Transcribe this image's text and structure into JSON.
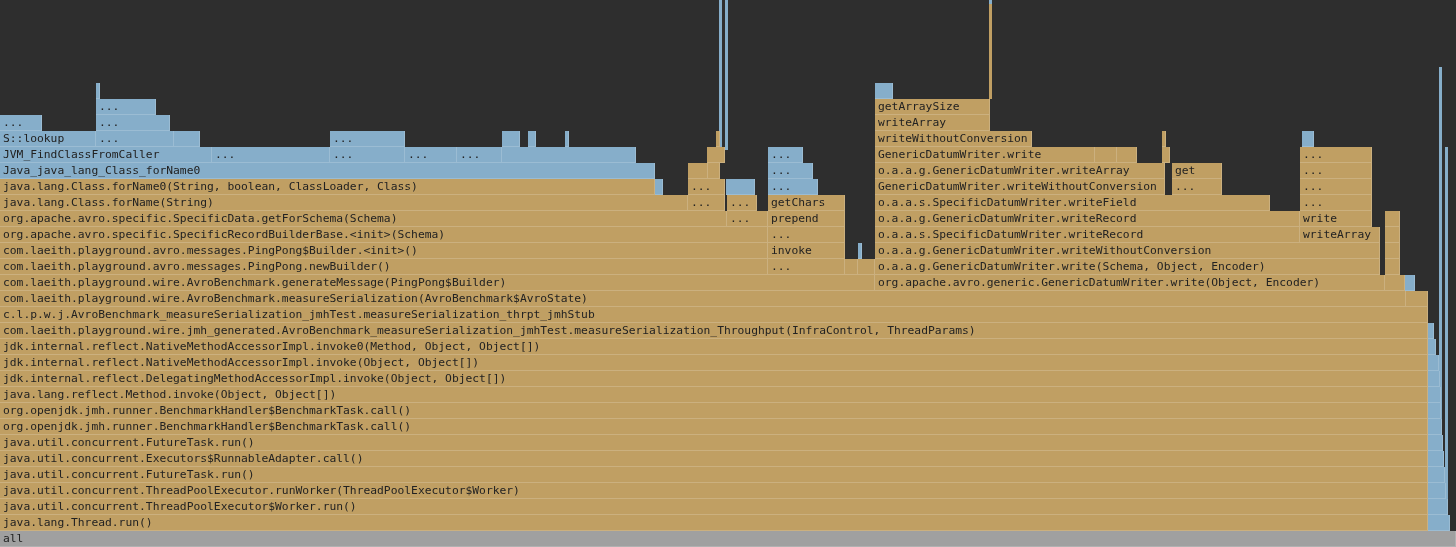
{
  "flame_graph": {
    "rows": [
      {
        "frames": [
          {
            "kind": "native"
          },
          {
            "kind": "native"
          }
        ]
      },
      {
        "frames": [
          {
            "label": "...",
            "kind": "native"
          },
          {
            "label": "getArraySize",
            "kind": "java"
          }
        ]
      },
      {
        "frames": [
          {
            "label": "...",
            "kind": "native"
          },
          {
            "label": "...",
            "kind": "native"
          },
          {
            "label": "writeArray",
            "kind": "java"
          }
        ]
      },
      {
        "frames": [
          {
            "label": "S::lookup",
            "kind": "native"
          },
          {
            "label": "...",
            "kind": "native"
          },
          {
            "kind": "native"
          },
          {
            "label": "...",
            "kind": "native"
          },
          {
            "kind": "native"
          },
          {
            "kind": "native"
          },
          {
            "kind": "native"
          },
          {
            "kind": "java"
          },
          {
            "label": "writeWithoutConversion",
            "kind": "java"
          },
          {
            "kind": "java"
          },
          {
            "kind": "native"
          }
        ]
      },
      {
        "frames": [
          {
            "label": "JVM_FindClassFromCaller",
            "kind": "native"
          },
          {
            "label": "...",
            "kind": "native"
          },
          {
            "label": "...",
            "kind": "native"
          },
          {
            "label": "...",
            "kind": "native"
          },
          {
            "label": "...",
            "kind": "native"
          },
          {
            "kind": "native"
          },
          {
            "kind": "java"
          },
          {
            "label": "...",
            "kind": "native"
          },
          {
            "label": "GenericDatumWriter.write",
            "kind": "java"
          },
          {
            "kind": "java"
          },
          {
            "kind": "java"
          },
          {
            "kind": "java"
          },
          {
            "label": "...",
            "kind": "java"
          }
        ]
      },
      {
        "frames": [
          {
            "label": "Java_java_lang_Class_forName0",
            "kind": "native"
          },
          {
            "kind": "java"
          },
          {
            "kind": "java"
          },
          {
            "label": "...",
            "kind": "native"
          },
          {
            "label": "o.a.a.g.GenericDatumWriter.writeArray",
            "kind": "java"
          },
          {
            "label": "get",
            "kind": "java"
          },
          {
            "label": "...",
            "kind": "java"
          }
        ]
      },
      {
        "frames": [
          {
            "label": "java.lang.Class.forName0(String, boolean, ClassLoader, Class)",
            "kind": "java"
          },
          {
            "kind": "native"
          },
          {
            "label": "...",
            "kind": "java"
          },
          {
            "kind": "native"
          },
          {
            "label": "...",
            "kind": "native"
          },
          {
            "label": "GenericDatumWriter.writeWithoutConversion",
            "kind": "java"
          },
          {
            "label": "...",
            "kind": "java"
          },
          {
            "label": "...",
            "kind": "java"
          }
        ]
      },
      {
        "frames": [
          {
            "label": "java.lang.Class.forName(String)",
            "kind": "java"
          },
          {
            "label": "...",
            "kind": "java"
          },
          {
            "label": "...",
            "kind": "java"
          },
          {
            "label": "getChars",
            "kind": "java"
          },
          {
            "label": "o.a.a.s.SpecificDatumWriter.writeField",
            "kind": "java"
          },
          {
            "label": "...",
            "kind": "java"
          }
        ]
      },
      {
        "frames": [
          {
            "label": "org.apache.avro.specific.SpecificData.getForSchema(Schema)",
            "kind": "java"
          },
          {
            "label": "...",
            "kind": "java"
          },
          {
            "label": "prepend",
            "kind": "java"
          },
          {
            "label": "o.a.a.g.GenericDatumWriter.writeRecord",
            "kind": "java"
          },
          {
            "label": "write",
            "kind": "java"
          },
          {
            "kind": "java"
          }
        ]
      },
      {
        "frames": [
          {
            "label": "org.apache.avro.specific.SpecificRecordBuilderBase.<init>(Schema)",
            "kind": "java"
          },
          {
            "label": "...",
            "kind": "java"
          },
          {
            "label": "o.a.a.s.SpecificDatumWriter.writeRecord",
            "kind": "java"
          },
          {
            "label": "writeArray",
            "kind": "java"
          },
          {
            "kind": "java"
          }
        ]
      },
      {
        "frames": [
          {
            "label": "com.laeith.playground.avro.messages.PingPong$Builder.<init>()",
            "kind": "java"
          },
          {
            "label": "invoke",
            "kind": "java"
          },
          {
            "kind": "native"
          },
          {
            "label": "o.a.a.g.GenericDatumWriter.writeWithoutConversion",
            "kind": "java"
          },
          {
            "kind": "java"
          }
        ]
      },
      {
        "frames": [
          {
            "label": "com.laeith.playground.avro.messages.PingPong.newBuilder()",
            "kind": "java"
          },
          {
            "label": "...",
            "kind": "java"
          },
          {
            "kind": "java"
          },
          {
            "kind": "java"
          },
          {
            "label": "o.a.a.g.GenericDatumWriter.write(Schema, Object, Encoder)",
            "kind": "java"
          },
          {
            "kind": "java"
          }
        ]
      },
      {
        "frames": [
          {
            "label": "com.laeith.playground.wire.AvroBenchmark.generateMessage(PingPong$Builder)",
            "kind": "java"
          },
          {
            "label": "org.apache.avro.generic.GenericDatumWriter.write(Object, Encoder)",
            "kind": "java"
          },
          {
            "kind": "java"
          },
          {
            "kind": "native"
          }
        ]
      },
      {
        "frames": [
          {
            "label": "com.laeith.playground.wire.AvroBenchmark.measureSerialization(AvroBenchmark$AvroState)",
            "kind": "java"
          },
          {
            "kind": "java"
          }
        ]
      },
      {
        "frames": [
          {
            "label": "c.l.p.w.j.AvroBenchmark_measureSerialization_jmhTest.measureSerialization_thrpt_jmhStub",
            "kind": "java"
          }
        ]
      },
      {
        "frames": [
          {
            "label": "com.laeith.playground.wire.jmh_generated.AvroBenchmark_measureSerialization_jmhTest.measureSerialization_Throughput(InfraControl, ThreadParams)",
            "kind": "java"
          },
          {
            "kind": "native"
          }
        ]
      },
      {
        "frames": [
          {
            "label": "jdk.internal.reflect.NativeMethodAccessorImpl.invoke0(Method, Object, Object[])",
            "kind": "java"
          },
          {
            "kind": "native"
          }
        ]
      },
      {
        "frames": [
          {
            "label": "jdk.internal.reflect.NativeMethodAccessorImpl.invoke(Object, Object[])",
            "kind": "java"
          },
          {
            "kind": "native"
          }
        ]
      },
      {
        "frames": [
          {
            "label": "jdk.internal.reflect.DelegatingMethodAccessorImpl.invoke(Object, Object[])",
            "kind": "java"
          },
          {
            "kind": "native"
          }
        ]
      },
      {
        "frames": [
          {
            "label": "java.lang.reflect.Method.invoke(Object, Object[])",
            "kind": "java"
          },
          {
            "kind": "native"
          }
        ]
      },
      {
        "frames": [
          {
            "label": "org.openjdk.jmh.runner.BenchmarkHandler$BenchmarkTask.call()",
            "kind": "java"
          },
          {
            "kind": "native"
          }
        ]
      },
      {
        "frames": [
          {
            "label": "org.openjdk.jmh.runner.BenchmarkHandler$BenchmarkTask.call()",
            "kind": "java"
          },
          {
            "kind": "native"
          }
        ]
      },
      {
        "frames": [
          {
            "label": "java.util.concurrent.FutureTask.run()",
            "kind": "java"
          },
          {
            "kind": "native"
          }
        ]
      },
      {
        "frames": [
          {
            "label": "java.util.concurrent.Executors$RunnableAdapter.call()",
            "kind": "java"
          },
          {
            "kind": "native"
          }
        ]
      },
      {
        "frames": [
          {
            "label": "java.util.concurrent.FutureTask.run()",
            "kind": "java"
          },
          {
            "kind": "native"
          }
        ]
      },
      {
        "frames": [
          {
            "label": "java.util.concurrent.ThreadPoolExecutor.runWorker(ThreadPoolExecutor$Worker)",
            "kind": "java"
          },
          {
            "kind": "native"
          }
        ]
      },
      {
        "frames": [
          {
            "label": "java.util.concurrent.ThreadPoolExecutor$Worker.run()",
            "kind": "java"
          },
          {
            "kind": "native"
          }
        ]
      },
      {
        "frames": [
          {
            "label": "java.lang.Thread.run()",
            "kind": "java"
          },
          {
            "kind": "native"
          }
        ]
      },
      {
        "frames": [
          {
            "label": "all",
            "kind": "root"
          }
        ]
      }
    ]
  }
}
